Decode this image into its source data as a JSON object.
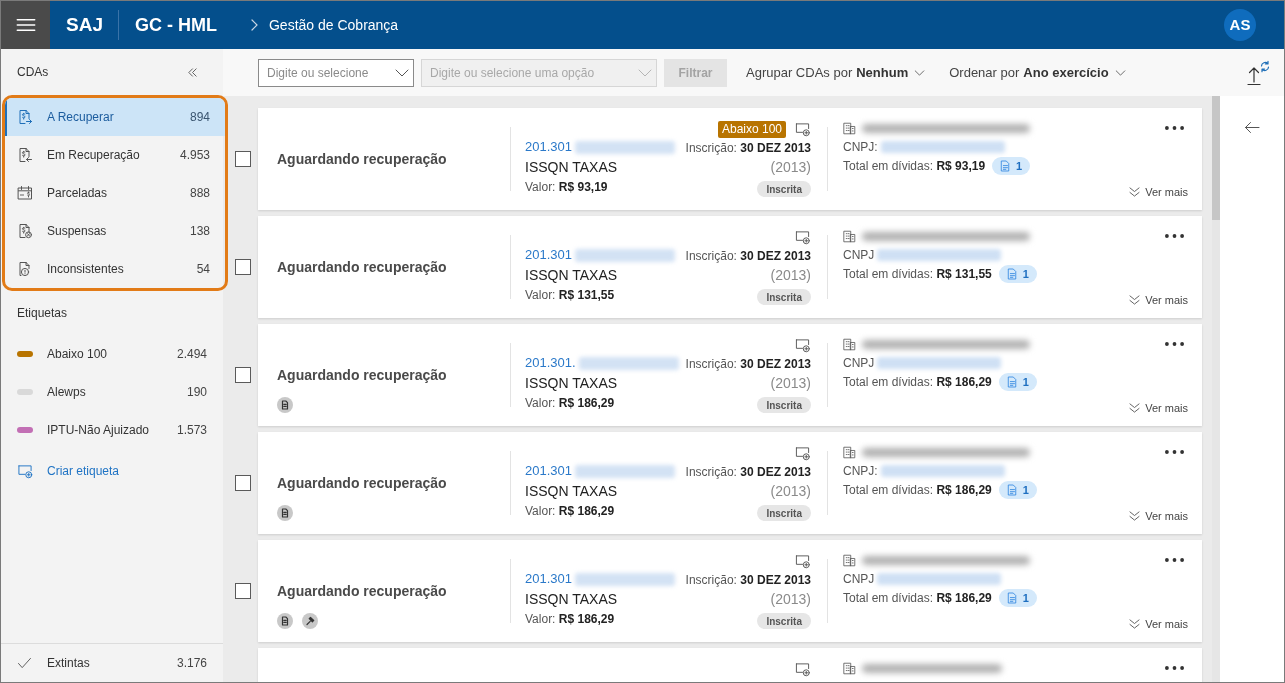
{
  "header": {
    "app": "SAJ",
    "module": "GC - HML",
    "breadcrumb": "Gestão de Cobrança",
    "avatar": "AS"
  },
  "sidebar": {
    "title": "CDAs",
    "cdas": {
      "highlighted": true,
      "items": [
        {
          "kind": "outgoing",
          "label": "A Recuperar",
          "count": "894",
          "selected": true
        },
        {
          "kind": "incoming",
          "label": "Em Recuperação",
          "count": "4.953",
          "selected": false
        },
        {
          "kind": "installments",
          "label": "Parceladas",
          "count": "888",
          "selected": false
        },
        {
          "kind": "suspended",
          "label": "Suspensas",
          "count": "138",
          "selected": false
        },
        {
          "kind": "inconsistent",
          "label": "Inconsistentes",
          "count": "54",
          "selected": false
        }
      ]
    },
    "tags_title": "Etiquetas",
    "tags": [
      {
        "label": "Abaixo 100",
        "count": "2.494",
        "color": "#b87400"
      },
      {
        "label": "Alewps",
        "count": "190",
        "color": "#d9d9d9"
      },
      {
        "label": "IPTU-Não Ajuizado",
        "count": "1.573",
        "color": "#c26fb4"
      }
    ],
    "create_tag": "Criar etiqueta",
    "footer": {
      "label": "Extintas",
      "count": "3.176"
    }
  },
  "toolbar": {
    "select_1": {
      "placeholder": "Digite ou selecione",
      "disabled": false
    },
    "select_2": {
      "placeholder": "Digite ou selecione uma opção",
      "disabled": true
    },
    "filter_button": {
      "label": "Filtrar",
      "disabled": true
    },
    "group_by": {
      "label": "Agrupar CDAs por",
      "value": "Nenhum"
    },
    "sort_by": {
      "label": "Ordenar por",
      "value": "Ano exercício"
    }
  },
  "cards": [
    {
      "kind": "full",
      "checked": false,
      "status": "Aguardando recuperação",
      "number": "201.301",
      "tribute": "ISSQN TAXAS",
      "value_label": "Valor:",
      "value": "R$ 93,19",
      "tag": {
        "label": "Abaixo 100",
        "color": "#b87400"
      },
      "date_label": "Inscrição:",
      "date": "30 DEZ 2013",
      "year": "(2013)",
      "badge": "Inscrita",
      "cnpj_label": "CNPJ:",
      "total_label": "Total em dívidas:",
      "total": "R$ 93,19",
      "doc_count": "1",
      "more": "Ver mais"
    },
    {
      "kind": "full",
      "checked": false,
      "status": "Aguardando recuperação",
      "number": "201.301",
      "tribute": "ISSQN TAXAS",
      "value_label": "Valor:",
      "value": "R$ 131,55",
      "date_label": "Inscrição:",
      "date": "30 DEZ 2013",
      "year": "(2013)",
      "badge": "Inscrita",
      "cnpj_label": "CNPJ",
      "total_label": "Total em dívidas:",
      "total": "R$ 131,55",
      "doc_count": "1",
      "more": "Ver mais"
    },
    {
      "kind": "full",
      "checked": false,
      "status": "Aguardando recuperação",
      "indicators": [
        {
          "kind": "document"
        }
      ],
      "number": "201.301.",
      "tribute": "ISSQN TAXAS",
      "value_label": "Valor:",
      "value": "R$ 186,29",
      "date_label": "Inscrição:",
      "date": "30 DEZ 2013",
      "year": "(2013)",
      "badge": "Inscrita",
      "cnpj_label": "CNPJ",
      "total_label": "Total em dívidas:",
      "total": "R$ 186,29",
      "doc_count": "1",
      "more": "Ver mais"
    },
    {
      "kind": "full",
      "checked": false,
      "status": "Aguardando recuperação",
      "indicators": [
        {
          "kind": "document"
        }
      ],
      "number": "201.301",
      "tribute": "ISSQN TAXAS",
      "value_label": "Valor:",
      "value": "R$ 186,29",
      "date_label": "Inscrição:",
      "date": "30 DEZ 2013",
      "year": "(2013)",
      "badge": "Inscrita",
      "cnpj_label": "CNPJ:",
      "total_label": "Total em dívidas:",
      "total": "R$ 186,29",
      "doc_count": "1",
      "more": "Ver mais"
    },
    {
      "kind": "full",
      "checked": false,
      "status": "Aguardando recuperação",
      "indicators": [
        {
          "kind": "document"
        },
        {
          "kind": "hammer"
        }
      ],
      "number": "201.301",
      "tribute": "ISSQN TAXAS",
      "value_label": "Valor:",
      "value": "R$ 186,29",
      "date_label": "Inscrição:",
      "date": "30 DEZ 2013",
      "year": "(2013)",
      "badge": "Inscrita",
      "cnpj_label": "CNPJ",
      "total_label": "Total em dívidas:",
      "total": "R$ 186,29",
      "doc_count": "1",
      "more": "Ver mais"
    },
    {
      "kind": "cut"
    }
  ]
}
